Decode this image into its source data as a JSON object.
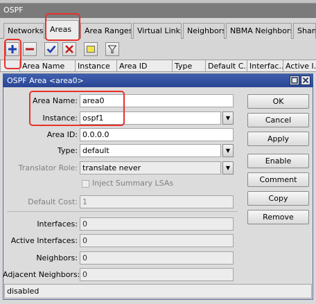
{
  "ospf_window": {
    "title": "OSPF",
    "tabs": [
      "Networks",
      "Areas",
      "Area Ranges",
      "Virtual Links",
      "Neighbors",
      "NBMA Neighbors",
      "Sham"
    ],
    "active_tab": "Areas",
    "columns": [
      "Area Name",
      "Instance",
      "Area ID",
      "Type",
      "Default C...",
      "Interfac...",
      "Active I..."
    ]
  },
  "toolbar": {
    "icons": [
      "plus-icon",
      "minus-icon",
      "check-icon",
      "x-icon",
      "comment-icon",
      "filter-icon"
    ],
    "colors": {
      "plus": "#1b3fb0",
      "minus": "#b81e1e",
      "check": "#1b3fb0",
      "x": "#c41e1e",
      "comment": "#f2e24a"
    }
  },
  "dialog": {
    "title": "OSPF Area <area0>",
    "fields": {
      "area_name": {
        "label": "Area Name:",
        "value": "area0"
      },
      "instance": {
        "label": "Instance:",
        "value": "ospf1"
      },
      "area_id": {
        "label": "Area ID:",
        "value": "0.0.0.0"
      },
      "type": {
        "label": "Type:",
        "value": "default"
      },
      "translator_role": {
        "label": "Translator Role:",
        "value": "translate never"
      },
      "inject_summary": {
        "label": "Inject Summary LSAs"
      },
      "default_cost": {
        "label": "Default Cost:",
        "value": "1"
      },
      "interfaces": {
        "label": "Interfaces:",
        "value": "0"
      },
      "active_interfaces": {
        "label": "Active Interfaces:",
        "value": "0"
      },
      "neighbors": {
        "label": "Neighbors:",
        "value": "0"
      },
      "adjacent_neighbors": {
        "label": "Adjacent Neighbors:",
        "value": "0"
      }
    },
    "buttons": {
      "ok": "OK",
      "cancel": "Cancel",
      "apply": "Apply",
      "enable": "Enable",
      "comment": "Comment",
      "copy": "Copy",
      "remove": "Remove"
    },
    "status": "disabled"
  },
  "highlight_color": "#e8302a"
}
